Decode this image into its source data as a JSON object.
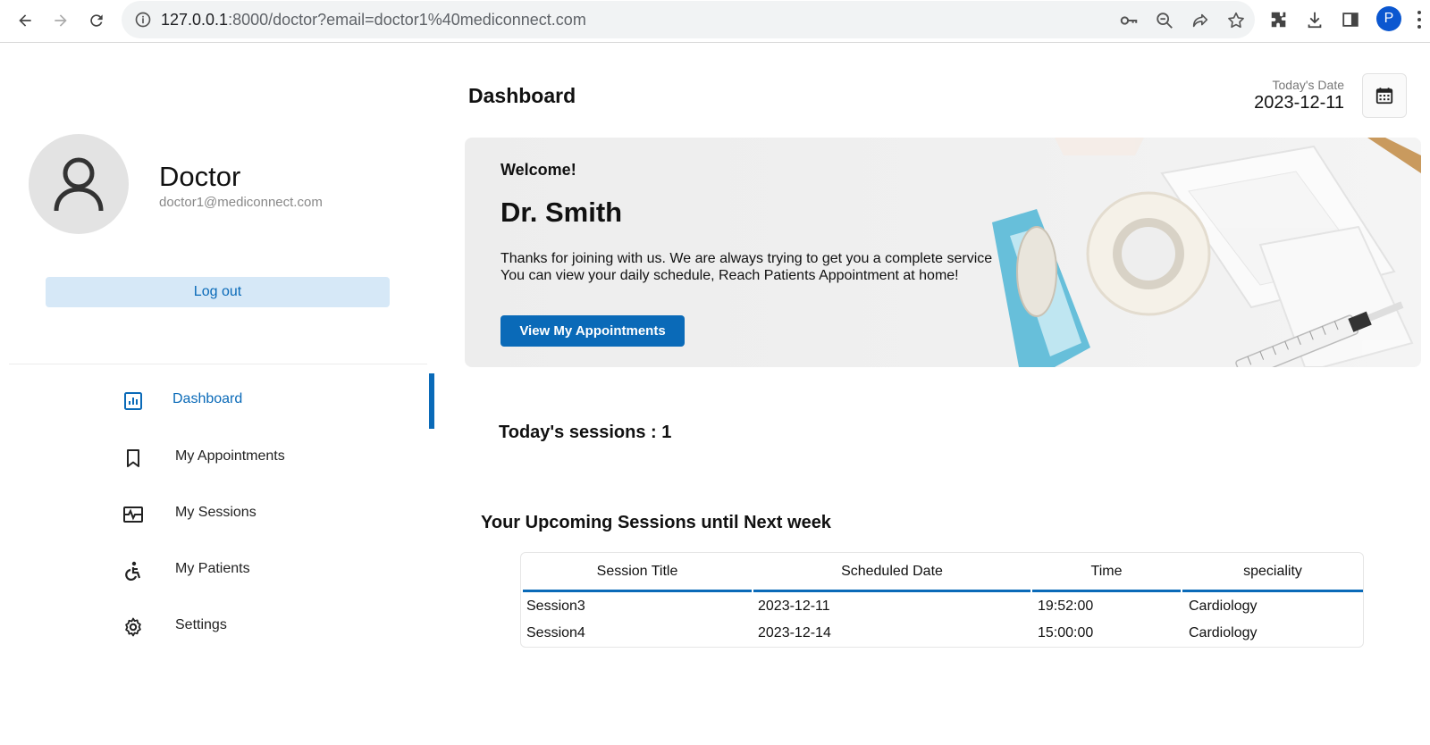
{
  "browser": {
    "url_host": "127.0.0.1",
    "url_rest": ":8000/doctor?email=doctor1%40mediconnect.com",
    "profile_initial": "P",
    "icons": [
      "back-icon",
      "forward-icon",
      "reload-icon",
      "site-info-icon",
      "key-icon",
      "zoom-out-icon",
      "share-icon",
      "star-icon",
      "extensions-icon",
      "download-icon",
      "side-panel-icon",
      "kebab-menu-icon"
    ]
  },
  "profile": {
    "name": "Doctor",
    "email": "doctor1@mediconnect.com",
    "logout_label": "Log out"
  },
  "sidebar": {
    "items": [
      {
        "label": "Dashboard",
        "icon": "dashboard-icon",
        "active": true
      },
      {
        "label": "My Appointments",
        "icon": "bookmark-icon",
        "active": false
      },
      {
        "label": "My Sessions",
        "icon": "sessions-icon",
        "active": false
      },
      {
        "label": "My Patients",
        "icon": "accessibility-icon",
        "active": false
      },
      {
        "label": "Settings",
        "icon": "gear-icon",
        "active": false
      }
    ]
  },
  "header": {
    "title": "Dashboard",
    "date_label": "Today's Date",
    "date_value": "2023-12-11"
  },
  "banner": {
    "welcome": "Welcome!",
    "doctor_name": "Dr. Smith",
    "line1": "Thanks for joining with us. We are always trying to get you a complete service",
    "line2": "You can view your daily schedule, Reach Patients Appointment at home!",
    "button_label": "View My Appointments"
  },
  "sessions": {
    "today_label": "Today's sessions : 1",
    "upcoming_title": "Your Upcoming Sessions until Next week",
    "columns": [
      "Session Title",
      "Scheduled Date",
      "Time",
      "speciality"
    ],
    "rows": [
      [
        "Session3",
        "2023-12-11",
        "19:52:00",
        "Cardiology"
      ],
      [
        "Session4",
        "2023-12-14",
        "15:00:00",
        "Cardiology"
      ]
    ]
  },
  "colors": {
    "accent": "#0a6ab8",
    "logout_bg": "#d6e8f7",
    "avatar_bg": "#e3e3e3"
  }
}
